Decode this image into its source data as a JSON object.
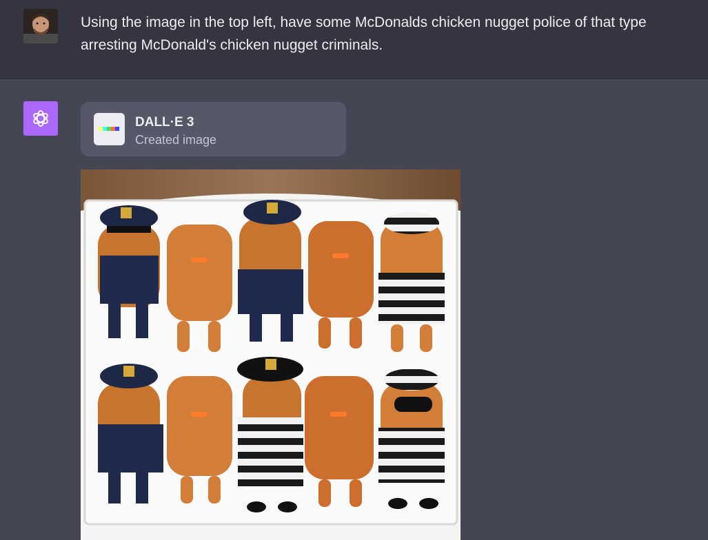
{
  "user_message": {
    "text": "Using the image in the top left, have some McDonalds chicken nugget police of that type arresting McDonald's chicken nugget criminals."
  },
  "assistant": {
    "tool": {
      "name": "DALL·E 3",
      "status": "Created image"
    }
  },
  "colors": {
    "background_user": "#343541",
    "background_assistant": "#444654",
    "logo_bg": "#ab68ff",
    "card_bg": "#565869"
  }
}
